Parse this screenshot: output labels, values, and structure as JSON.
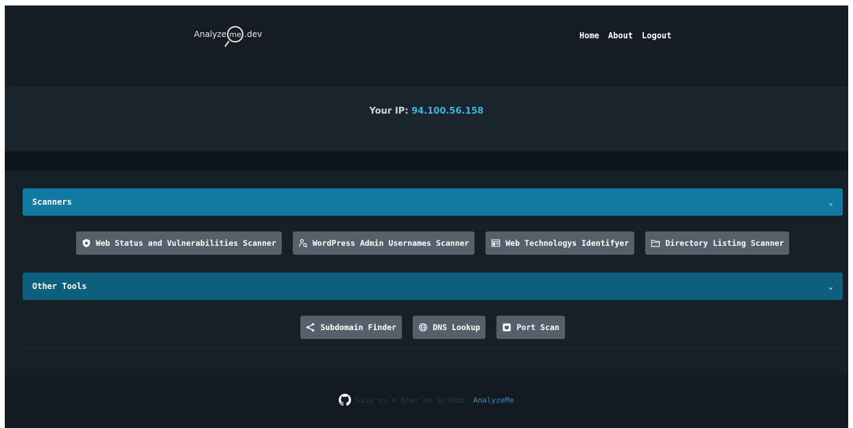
{
  "brand": {
    "prefix": "Analyze",
    "ring": "me",
    "suffix": ".dev"
  },
  "nav": {
    "items": [
      "Home",
      "About",
      "Logout"
    ]
  },
  "ip": {
    "label": "Your IP:",
    "value": "94.100.56.158"
  },
  "sections": [
    {
      "title": "Scanners",
      "chevron": "⌄",
      "buttons": [
        {
          "label": "Web Status and Vulnerabilities Scanner",
          "icon": "shield-icon"
        },
        {
          "label": "WordPress Admin Usernames Scanner",
          "icon": "user-search-icon"
        },
        {
          "label": "Web Technologys Identifyer",
          "icon": "browser-window-icon"
        },
        {
          "label": "Directory Listing Scanner",
          "icon": "folder-icon"
        }
      ]
    },
    {
      "title": "Other Tools",
      "chevron": "⌄",
      "buttons": [
        {
          "label": "Subdomain Finder",
          "icon": "share-nodes-icon"
        },
        {
          "label": "DNS Lookup",
          "icon": "globe-icon"
        },
        {
          "label": "Port Scan",
          "icon": "port-icon"
        }
      ]
    }
  ],
  "footer": {
    "text": "Give us a Star on GitHub:",
    "link": "AnalyzeMe",
    "icon": "github-icon"
  },
  "colors": {
    "accent": "#117aa2",
    "accent_dark": "#0d5f7e",
    "ip_value": "#3fb6d8",
    "button": "#56606b",
    "link": "#2f8cc6"
  }
}
